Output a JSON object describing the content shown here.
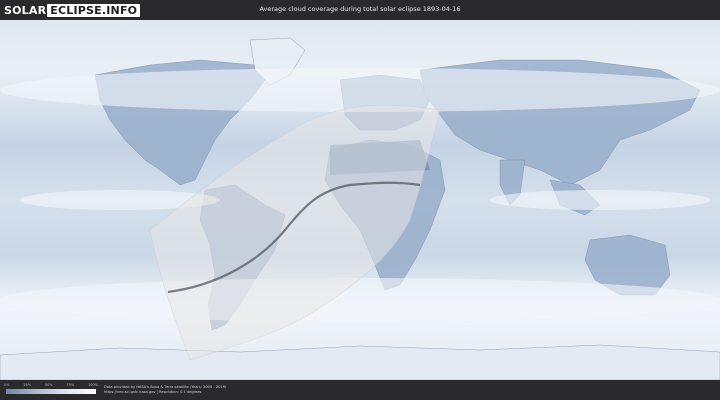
{
  "header": {
    "logo_part1": "SOLAR",
    "logo_part2": "ECLIPSE.INFO",
    "title": "Average cloud coverage during total solar eclipse 1893-04-16"
  },
  "legend": {
    "ticks": [
      "0%",
      "25%",
      "50%",
      "75%",
      "100%"
    ],
    "colors": [
      "#6f86a8",
      "#a9bbd3",
      "#dfe7f1",
      "#ffffff"
    ]
  },
  "credits": {
    "line1": "Data provided by NASA's Aqua & Terra satellite (Years: 2000 - 2019)",
    "line2": "https://neo.sci.gsfc.nasa.gov | Resolution: 0.1 degrees"
  },
  "colors": {
    "ocean_cloud": "#c7d5e6",
    "land": "#8ea5c4",
    "heavy_cloud": "#f4f7fb",
    "eclipse_band": "#e7e7e7",
    "path_line": "#5a5f68"
  }
}
